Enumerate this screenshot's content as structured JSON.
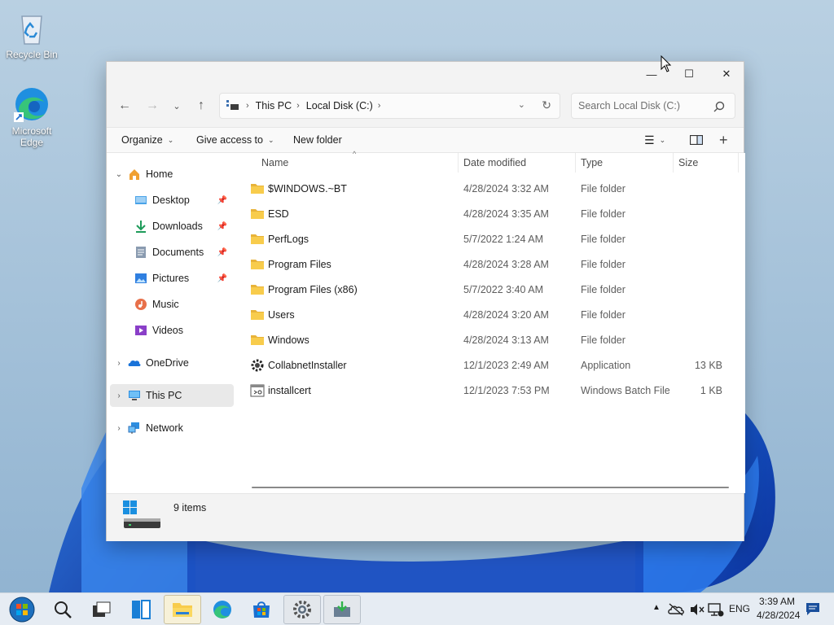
{
  "desktop": {
    "icons": [
      {
        "label": "Recycle Bin",
        "icon": "recycle-bin-icon"
      },
      {
        "label": "Microsoft Edge",
        "icon": "edge-icon"
      }
    ]
  },
  "window": {
    "controls": {
      "minimize": "—",
      "maximize": "☐",
      "close": "✕"
    },
    "address": {
      "crumbs": [
        "This PC",
        "Local Disk (C:)"
      ],
      "search_placeholder": "Search Local Disk (C:)"
    },
    "command_bar": {
      "organize": "Organize",
      "give_access": "Give access to",
      "new_folder": "New folder"
    },
    "nav_pane": {
      "home": "Home",
      "quick_access": [
        {
          "label": "Desktop",
          "pinned": true,
          "icon": "desktop-icon"
        },
        {
          "label": "Downloads",
          "pinned": true,
          "icon": "downloads-icon"
        },
        {
          "label": "Documents",
          "pinned": true,
          "icon": "documents-icon"
        },
        {
          "label": "Pictures",
          "pinned": true,
          "icon": "pictures-icon"
        },
        {
          "label": "Music",
          "pinned": false,
          "icon": "music-icon"
        },
        {
          "label": "Videos",
          "pinned": false,
          "icon": "videos-icon"
        }
      ],
      "onedrive": "OneDrive",
      "this_pc": "This PC",
      "network": "Network",
      "selected": "This PC"
    },
    "columns": [
      "Name",
      "Date modified",
      "Type",
      "Size"
    ],
    "files": [
      {
        "name": "$WINDOWS.~BT",
        "date": "4/28/2024 3:32 AM",
        "type": "File folder",
        "size": "",
        "icon": "folder-icon"
      },
      {
        "name": "ESD",
        "date": "4/28/2024 3:35 AM",
        "type": "File folder",
        "size": "",
        "icon": "folder-icon"
      },
      {
        "name": "PerfLogs",
        "date": "5/7/2022 1:24 AM",
        "type": "File folder",
        "size": "",
        "icon": "folder-icon"
      },
      {
        "name": "Program Files",
        "date": "4/28/2024 3:28 AM",
        "type": "File folder",
        "size": "",
        "icon": "folder-icon"
      },
      {
        "name": "Program Files (x86)",
        "date": "5/7/2022 3:40 AM",
        "type": "File folder",
        "size": "",
        "icon": "folder-icon"
      },
      {
        "name": "Users",
        "date": "4/28/2024 3:20 AM",
        "type": "File folder",
        "size": "",
        "icon": "folder-icon"
      },
      {
        "name": "Windows",
        "date": "4/28/2024 3:13 AM",
        "type": "File folder",
        "size": "",
        "icon": "folder-icon"
      },
      {
        "name": "CollabnetInstaller",
        "date": "12/1/2023 2:49 AM",
        "type": "Application",
        "size": "13 KB",
        "icon": "application-icon"
      },
      {
        "name": "installcert",
        "date": "12/1/2023 7:53 PM",
        "type": "Windows Batch File",
        "size": "1 KB",
        "icon": "batch-file-icon"
      }
    ],
    "status": {
      "item_count": "9 items"
    }
  },
  "taskbar": {
    "tray": {
      "language": "ENG",
      "time": "3:39 AM",
      "date": "4/28/2024"
    }
  },
  "colors": {
    "folder": "#f8cc4c",
    "accent": "#0067c0",
    "selection": "#e9e9e9"
  }
}
